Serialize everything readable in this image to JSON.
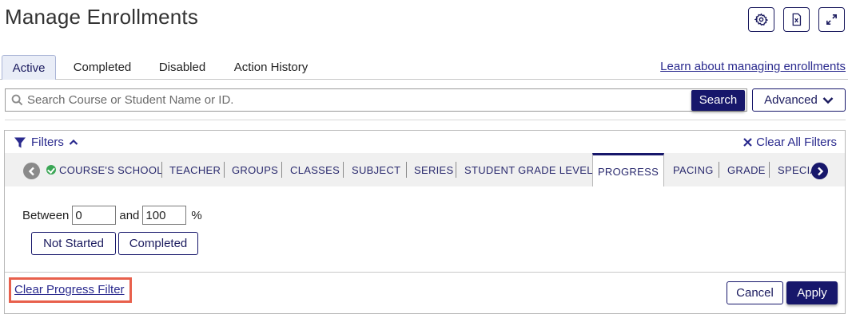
{
  "page": {
    "title": "Manage Enrollments"
  },
  "header_icons": [
    {
      "name": "settings",
      "icon": "gear-icon"
    },
    {
      "name": "export",
      "icon": "excel-file-icon"
    },
    {
      "name": "expand",
      "icon": "expand-arrows-icon"
    }
  ],
  "tabs": [
    {
      "label": "Active",
      "active": true
    },
    {
      "label": "Completed",
      "active": false
    },
    {
      "label": "Disabled",
      "active": false
    },
    {
      "label": "Action History",
      "active": false
    }
  ],
  "learn_link": "Learn about managing enrollments",
  "search": {
    "placeholder": "Search Course or Student Name or ID.",
    "value": "",
    "button_label": "Search",
    "advanced_label": "Advanced"
  },
  "filters": {
    "toggle_label": "Filters",
    "clear_all_label": "Clear All Filters",
    "categories": [
      {
        "label": "COURSE'S SCHOOL",
        "checked": true
      },
      {
        "label": "TEACHER"
      },
      {
        "label": "GROUPS"
      },
      {
        "label": "CLASSES"
      },
      {
        "label": "SUBJECT"
      },
      {
        "label": "SERIES"
      },
      {
        "label": "STUDENT GRADE LEVEL"
      },
      {
        "label": "PROGRESS",
        "active": true
      },
      {
        "label": "PACING"
      },
      {
        "label": "GRADE"
      },
      {
        "label": "SPECIA"
      }
    ],
    "progress": {
      "between_label": "Between",
      "and_label": "and",
      "min": "0",
      "max": "100",
      "unit": "%",
      "quick_buttons": [
        "Not Started",
        "Completed"
      ]
    },
    "clear_progress_label": "Clear Progress Filter",
    "cancel_label": "Cancel",
    "apply_label": "Apply"
  },
  "colors": {
    "primary": "#17176b",
    "link": "#2a2a8e",
    "check_green": "#3aa655",
    "highlight_border": "#e8604c"
  }
}
